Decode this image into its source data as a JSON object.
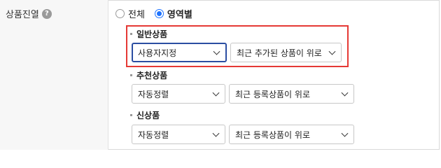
{
  "field": {
    "label": "상품진열",
    "help_icon": "question-mark-icon"
  },
  "display_mode": {
    "options": [
      {
        "label": "전체",
        "checked": false
      },
      {
        "label": "영역별",
        "checked": true
      }
    ]
  },
  "sections": [
    {
      "title": "일반상품",
      "sort_type": "사용자지정",
      "sort_order": "최근 추가된 상품이 위로"
    },
    {
      "title": "추천상품",
      "sort_type": "자동정렬",
      "sort_order": "최근 등록상품이 위로"
    },
    {
      "title": "신상품",
      "sort_type": "자동정렬",
      "sort_order": "최근 등록상품이 위로"
    }
  ],
  "colors": {
    "accent": "#1e73ff",
    "focus_border": "#2b4ea2",
    "highlight": "#e53935"
  }
}
